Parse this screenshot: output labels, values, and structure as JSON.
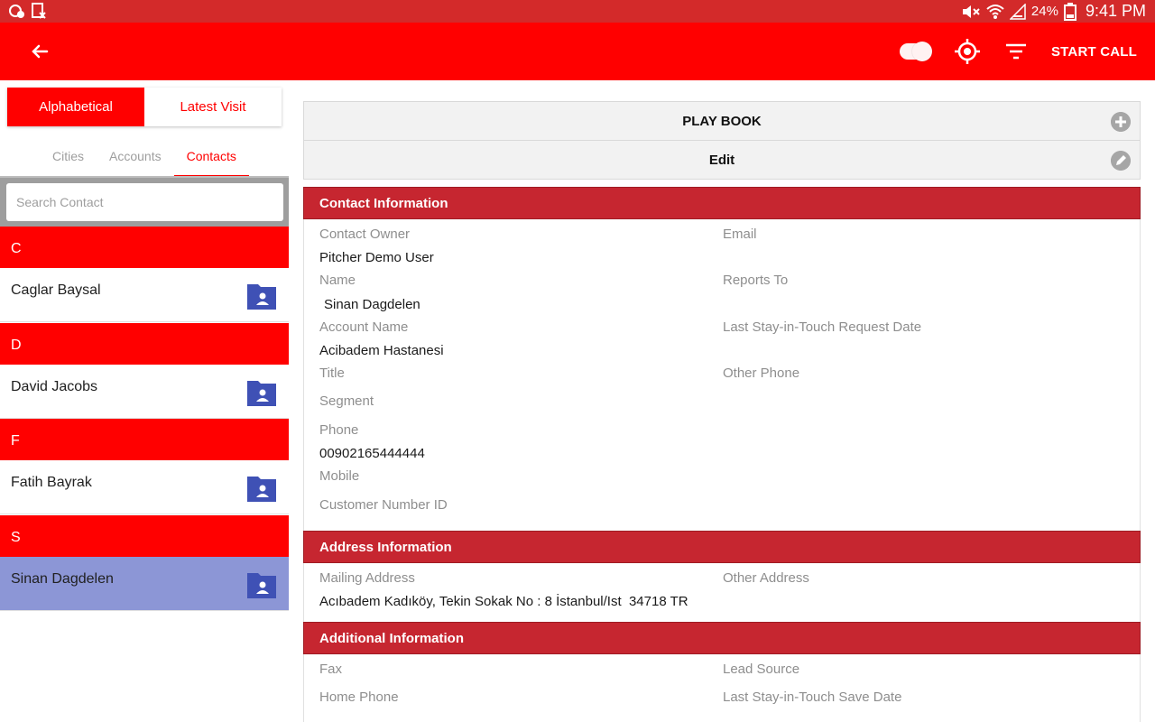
{
  "statusbar": {
    "battery": "24%",
    "time": "9:41 PM"
  },
  "appbar": {
    "start_call_label": "START CALL"
  },
  "sidebar": {
    "segments": {
      "alphabetical": "Alphabetical",
      "latest_visit": "Latest Visit"
    },
    "tabs": {
      "cities": "Cities",
      "accounts": "Accounts",
      "contacts": "Contacts"
    },
    "search": {
      "placeholder": "Search Contact",
      "value": ""
    },
    "groups": [
      {
        "letter": "C",
        "contact": "Caglar Baysal"
      },
      {
        "letter": "D",
        "contact": "David Jacobs"
      },
      {
        "letter": "F",
        "contact": "Fatih Bayrak"
      },
      {
        "letter": "S",
        "contact": "Sinan Dagdelen"
      }
    ],
    "selected_contact": "Sinan Dagdelen"
  },
  "main": {
    "playbook_label": "PLAY BOOK",
    "edit_label": "Edit",
    "contact_info": {
      "title": "Contact Information",
      "contact_owner_label": "Contact Owner",
      "contact_owner_value": "Pitcher Demo User",
      "email_label": "Email",
      "name_label": "Name",
      "name_value": "Sinan Dagdelen",
      "reports_to_label": "Reports To",
      "account_name_label": "Account Name",
      "account_name_value": "Acibadem Hastanesi",
      "last_sit_request_label": "Last Stay-in-Touch Request Date",
      "title_label": "Title",
      "other_phone_label": "Other Phone",
      "segment_label": "Segment",
      "phone_label": "Phone",
      "phone_value": "00902165444444",
      "mobile_label": "Mobile",
      "customer_number_label": "Customer Number ID"
    },
    "address_info": {
      "title": "Address Information",
      "mailing_label": "Mailing Address",
      "mailing_value": "Acıbadem Kadıköy, Tekin Sokak No : 8 İstanbul/Ist  34718 TR",
      "other_label": "Other Address"
    },
    "additional_info": {
      "title": "Additional Information",
      "fax_label": "Fax",
      "lead_source_label": "Lead Source",
      "home_phone_label": "Home Phone",
      "last_sit_save_label": "Last Stay-in-Touch Save Date"
    }
  },
  "colors": {
    "appbar": "#ff0000",
    "statusbar": "#d32a2a",
    "section_header": "#c62630",
    "selected_row": "#8c96d6",
    "contact_icon": "#3f51b5"
  },
  "icons": [
    "back-arrow-icon",
    "toggle-icon",
    "location-target-icon",
    "filter-icon",
    "add-circle-icon",
    "edit-pencil-icon",
    "contact-folder-icon"
  ]
}
